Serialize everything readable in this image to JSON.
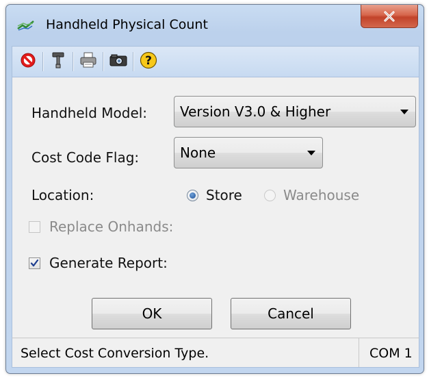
{
  "window": {
    "title": "Handheld Physical Count",
    "close_label": "X"
  },
  "toolbar": {
    "buttons": [
      {
        "icon": "cancel-icon"
      },
      {
        "icon": "tools-icon"
      },
      {
        "icon": "printer-icon"
      },
      {
        "icon": "camera-icon"
      },
      {
        "icon": "help-icon"
      }
    ]
  },
  "form": {
    "model_label": "Handheld Model:",
    "model_value": "Version V3.0 & Higher",
    "cost_code_label": "Cost Code Flag:",
    "cost_code_value": "None",
    "location_label": "Location:",
    "location_options": [
      {
        "label": "Store",
        "selected": true,
        "enabled": true
      },
      {
        "label": "Warehouse",
        "selected": false,
        "enabled": false
      }
    ],
    "replace_onhands_label": "Replace Onhands:",
    "replace_onhands_checked": false,
    "replace_onhands_enabled": false,
    "generate_report_label": "Generate Report:",
    "generate_report_checked": true
  },
  "buttons": {
    "ok_label": "OK",
    "cancel_label": "Cancel"
  },
  "status": {
    "message": "Select Cost Conversion Type.",
    "port": "COM 1"
  },
  "colors": {
    "frame": "#bcd1ec",
    "close_button": "#c2432a",
    "dialog_body": "#f0f0f0",
    "disabled_text": "#8a8a8a"
  }
}
